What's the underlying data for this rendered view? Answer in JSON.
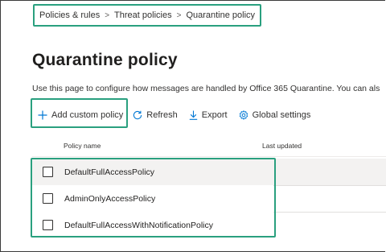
{
  "breadcrumb": {
    "items": [
      "Policies & rules",
      "Threat policies",
      "Quarantine policy"
    ],
    "separator": ">"
  },
  "page": {
    "title": "Quarantine policy",
    "description": "Use this page to configure how messages are handled by Office 365 Quarantine. You can als"
  },
  "toolbar": {
    "add_label": "Add custom policy",
    "refresh_label": "Refresh",
    "export_label": "Export",
    "global_settings_label": "Global settings"
  },
  "table": {
    "columns": [
      "Policy name",
      "Last updated"
    ],
    "rows": [
      {
        "name": "DefaultFullAccessPolicy",
        "last_updated": "",
        "checked": false
      },
      {
        "name": "AdminOnlyAccessPolicy",
        "last_updated": "",
        "checked": false
      },
      {
        "name": "DefaultFullAccessWithNotificationPolicy",
        "last_updated": "",
        "checked": false
      }
    ]
  },
  "colors": {
    "highlight": "#2aa07f",
    "accent": "#0078d4",
    "row_shade": "#f3f2f1",
    "text": "#323130"
  },
  "icons": {
    "add": "plus-icon",
    "refresh": "refresh-icon",
    "export": "download-icon",
    "global_settings": "gear-icon"
  }
}
